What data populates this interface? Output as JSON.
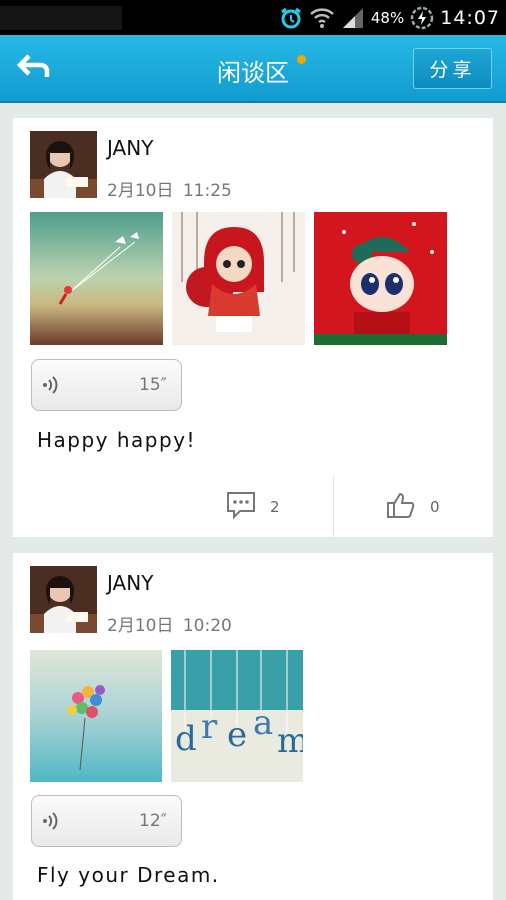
{
  "status_bar": {
    "battery_percent": "48%",
    "time": "14:07",
    "icons": [
      "alarm-icon",
      "wifi-icon",
      "signal-icon",
      "battery-charging-icon"
    ]
  },
  "header": {
    "back_icon": "back-arrow-icon",
    "title": "闲谈区",
    "notification_dot_color": "#f7a500",
    "share_label": "分享",
    "bar_color": "#1aa9dc"
  },
  "posts": [
    {
      "author": "JANY",
      "date": "2月10日",
      "time": "11:25",
      "voice_duration": "15″",
      "text": "Happy happy!",
      "comment_count": "2",
      "like_count": "0",
      "photos": [
        "kite-girl-photo",
        "red-hood-doll-photo",
        "cartoon-girl-photo"
      ]
    },
    {
      "author": "JANY",
      "date": "2月10日",
      "time": "10:20",
      "voice_duration": "12″",
      "text": "Fly your Dream.",
      "photos": [
        "balloons-photo",
        "dream-letters-photo"
      ]
    }
  ]
}
